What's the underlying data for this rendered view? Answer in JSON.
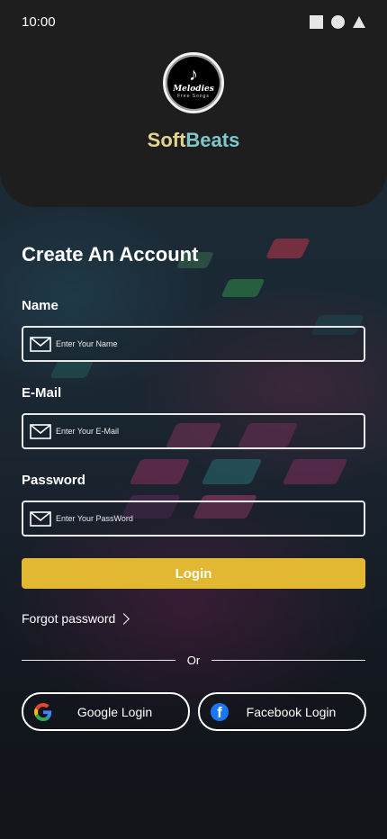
{
  "status_bar": {
    "time": "10:00"
  },
  "brand": {
    "logo_name": "Melodies",
    "logo_sub": "Free Songs",
    "name_part1": "Soft",
    "name_part2": "Beats"
  },
  "form": {
    "title": "Create An Account",
    "name": {
      "label": "Name",
      "placeholder": "Enter Your Name"
    },
    "email": {
      "label": "E-Mail",
      "placeholder": "Enter Your E-Mail"
    },
    "password": {
      "label": "Password",
      "placeholder": "Enter Your PassWord"
    },
    "login_label": "Login",
    "forgot_label": "Forgot password"
  },
  "divider_text": "Or",
  "social": {
    "google_label": "Google Login",
    "facebook_label": "Facebook Login"
  },
  "icons": [
    "square-icon",
    "circle-icon",
    "triangle-icon",
    "music-note-icon",
    "mail-icon",
    "chevron-right-icon",
    "google-icon",
    "facebook-icon"
  ],
  "colors": {
    "accent": "#e2b731",
    "brand_soft": "#e2d58f",
    "brand_beats": "#7fc7c8",
    "facebook": "#1877f2"
  }
}
